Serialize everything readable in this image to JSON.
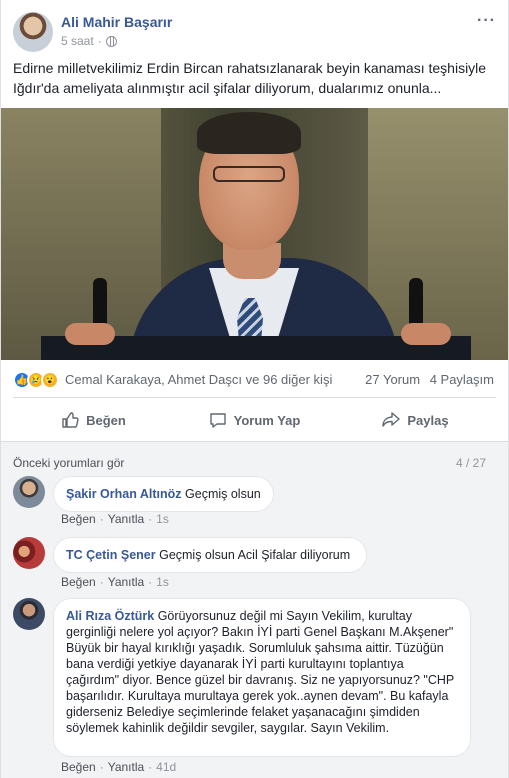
{
  "post": {
    "author": "Ali Mahir Başarır",
    "time": "5 saat",
    "text": "Edirne milletvekilimiz Erdin Bircan rahatsızlanarak beyin kanaması teşhisiyle Iğdır'da ameliyata alınmıştır acil şifalar diliyorum, dualarımız onunla...",
    "more_icon": "more-icon",
    "privacy_icon": "globe-icon"
  },
  "reactions": {
    "names": "Cemal Karakaya, Ahmet Daşcı ve 96 diğer kişi",
    "comments_count": "27 Yorum",
    "shares_count": "4 Paylaşım"
  },
  "actions": {
    "like": "Beğen",
    "comment": "Yorum Yap",
    "share": "Paylaş"
  },
  "comments_section": {
    "previous": "Önceki yorumları gör",
    "pager": "4 / 27",
    "like_label": "Beğen",
    "reply_label": "Yanıtla",
    "comments": [
      {
        "author": "Şakir Orhan Altınöz",
        "text": "Geçmiş olsun",
        "time": "1s"
      },
      {
        "author": "TC Çetin Şener",
        "text": "Geçmiş olsun Acil Şifalar diliyorum",
        "time": "1s"
      },
      {
        "author": "Ali Rıza Öztürk",
        "text": "Görüyorsunuz değil mi Sayın Vekilim, kurultay gerginliği nelere yol açıyor? Bakın İYİ parti Genel Başkanı M.Akşener\" Büyük bir hayal kırıklığı yaşadık. Sorumluluk şahsıma aittir. Tüzüğün bana verdiği yetkiye dayanarak İYİ parti kurultayını toplantıya çağırdım\" diyor. Bence güzel bir davranış. Siz ne yapıyorsunuz? \"CHP başarılıdır. Kurultaya murultaya gerek yok..aynen devam\". Bu kafayla giderseniz Belediye seçimlerinde felaket yaşanacağını şimdiden söylemek kahinlik değildir sevgiler, saygılar. Sayın Vekilim.",
        "time": "41d"
      }
    ]
  },
  "colors": {
    "link": "#385898",
    "like_reaction": "#1877f2",
    "sad_reaction": "#f7b125"
  }
}
